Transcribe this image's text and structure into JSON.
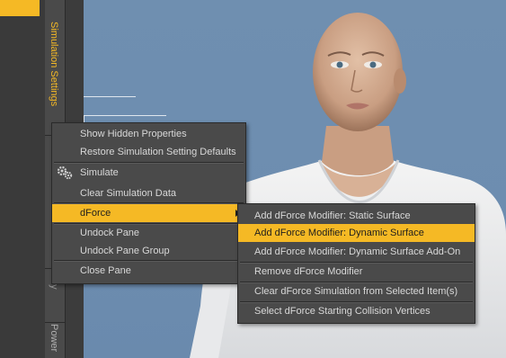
{
  "side_tabs": {
    "simulation_settings": "Simulation Settings",
    "partial_tab": "ny",
    "power_tab": "Power"
  },
  "context_menu": {
    "items": [
      {
        "label": "Show Hidden Properties"
      },
      {
        "label": "Restore Simulation Setting Defaults"
      },
      {
        "label": "Simulate",
        "icon": "gears-icon"
      },
      {
        "label": "Clear Simulation Data"
      },
      {
        "label": "dForce",
        "highlighted": true,
        "has_submenu": true
      },
      {
        "label": "Undock Pane"
      },
      {
        "label": "Undock Pane Group"
      },
      {
        "label": "Close Pane"
      }
    ]
  },
  "submenu": {
    "items": [
      {
        "label": "Add dForce Modifier: Static Surface"
      },
      {
        "label": "Add dForce Modifier: Dynamic Surface",
        "highlighted": true
      },
      {
        "label": "Add dForce Modifier: Dynamic Surface Add-On"
      },
      {
        "label": "Remove dForce Modifier"
      },
      {
        "label": "Clear dForce Simulation from Selected Item(s)"
      },
      {
        "label": "Select dForce Starting Collision Vertices"
      }
    ]
  },
  "colors": {
    "accent": "#f5b925",
    "menu_bg": "#4a4a4a",
    "viewport_bg": "#6f8fb0"
  }
}
